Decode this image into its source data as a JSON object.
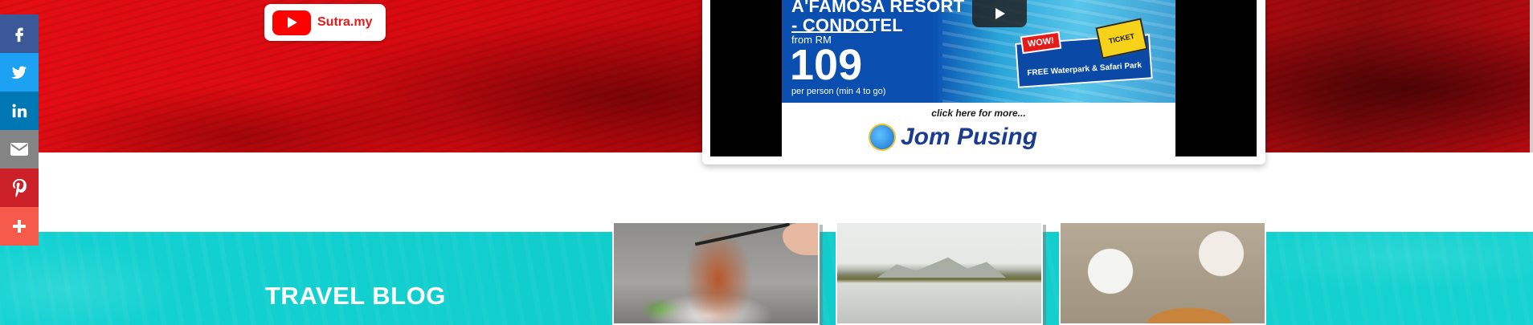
{
  "youtube_badge": {
    "label": "Sutra.my"
  },
  "video_ad": {
    "heading_line1": "A'FAMOSA RESORT",
    "heading_line2": "- CONDOTEL",
    "from_label": "from RM",
    "price": "109",
    "per_person": "per person (min 4 to go)",
    "wow_badge": "WOW!",
    "ticket_label": "TICKET",
    "promo_text": "FREE Waterpark & Safari Park",
    "click_more": "click here for more...",
    "brand": "Jom Pusing"
  },
  "share_buttons": [
    {
      "icon": "facebook-icon",
      "color": "#3b5998"
    },
    {
      "icon": "twitter-icon",
      "color": "#1da1f2"
    },
    {
      "icon": "linkedin-icon",
      "color": "#0077b5"
    },
    {
      "icon": "email-icon",
      "color": "#848484"
    },
    {
      "icon": "pinterest-icon",
      "color": "#cb2027"
    },
    {
      "icon": "more-icon",
      "color": "#f65a4a"
    }
  ],
  "travel_section": {
    "title": "TRAVEL BLOG",
    "thumbnails": [
      {
        "icon": "food-noodles-image"
      },
      {
        "icon": "lake-landscape-image"
      },
      {
        "icon": "breakfast-table-image"
      }
    ]
  },
  "colors": {
    "hero_red": "#d60a10",
    "teal": "#14d2d2",
    "youtube_red": "#ff0000"
  }
}
